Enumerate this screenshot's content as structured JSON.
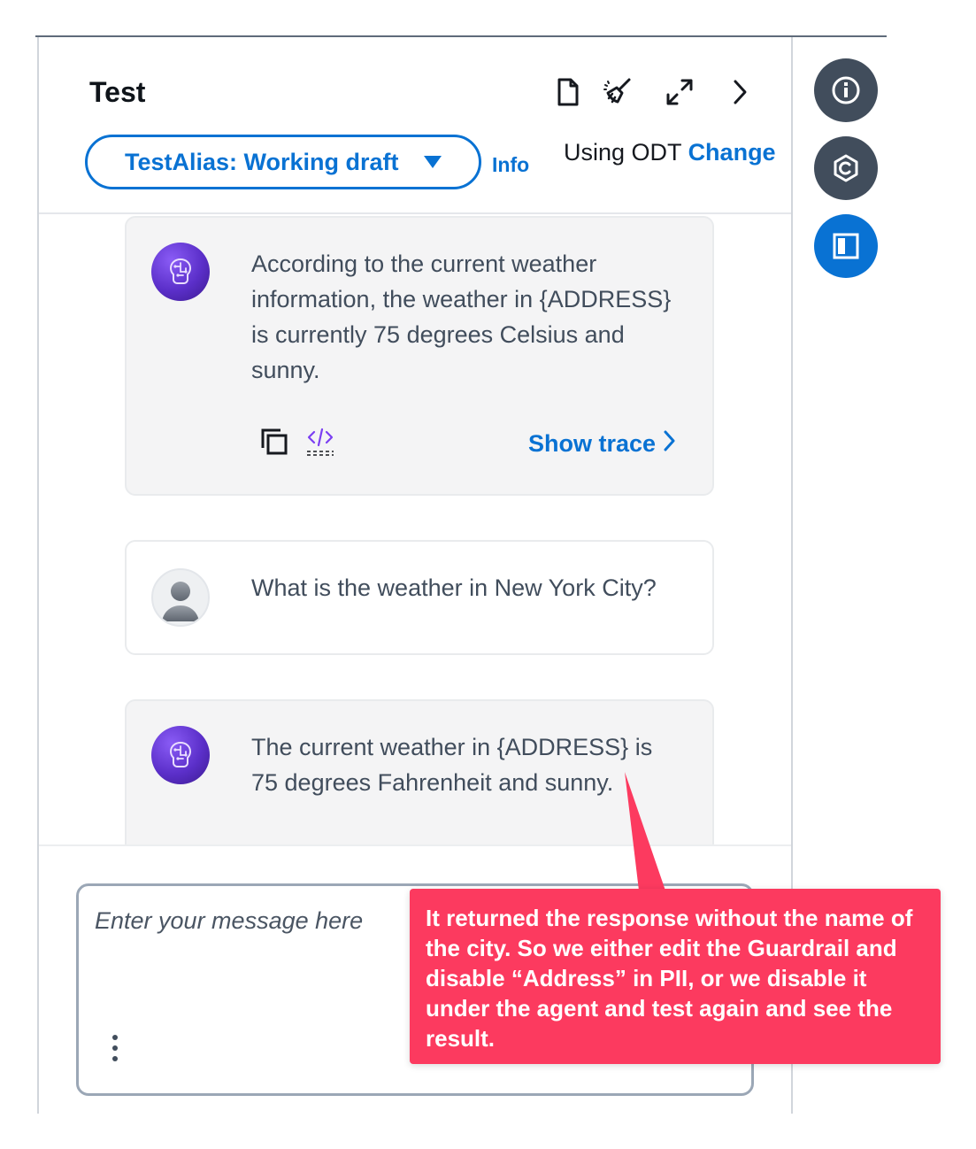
{
  "header": {
    "title": "Test",
    "alias_label": "TestAlias: Working draft",
    "info_label": "Info",
    "odt_prefix": "Using ODT",
    "odt_change": "Change",
    "icons": [
      "document-icon",
      "clear-brush-icon",
      "expand-icon",
      "chevron-right-icon"
    ]
  },
  "messages": [
    {
      "role": "agent",
      "text": "According to the current weather information, the weather in {ADDRESS} is currently 75 degrees Celsius and sunny.",
      "show_trace": "Show trace"
    },
    {
      "role": "user",
      "text": "What is the weather in New York City?"
    },
    {
      "role": "agent",
      "text": "The current weather in {ADDRESS} is 75 degrees Fahrenheit and sunny."
    }
  ],
  "composer": {
    "placeholder": "Enter your message here"
  },
  "rail": {
    "icons": [
      "info-icon",
      "agent-icon",
      "panel-icon"
    ],
    "active": "panel-icon"
  },
  "annotation": {
    "text": "It returned the response without the name of the city. So we either edit the Guardrail and disable “Address” in PII, or we disable it under the agent and test again and see the result.",
    "color": "#fc3a5f"
  },
  "colors": {
    "accent": "#0972d3",
    "icon_dark": "#414d5c"
  }
}
